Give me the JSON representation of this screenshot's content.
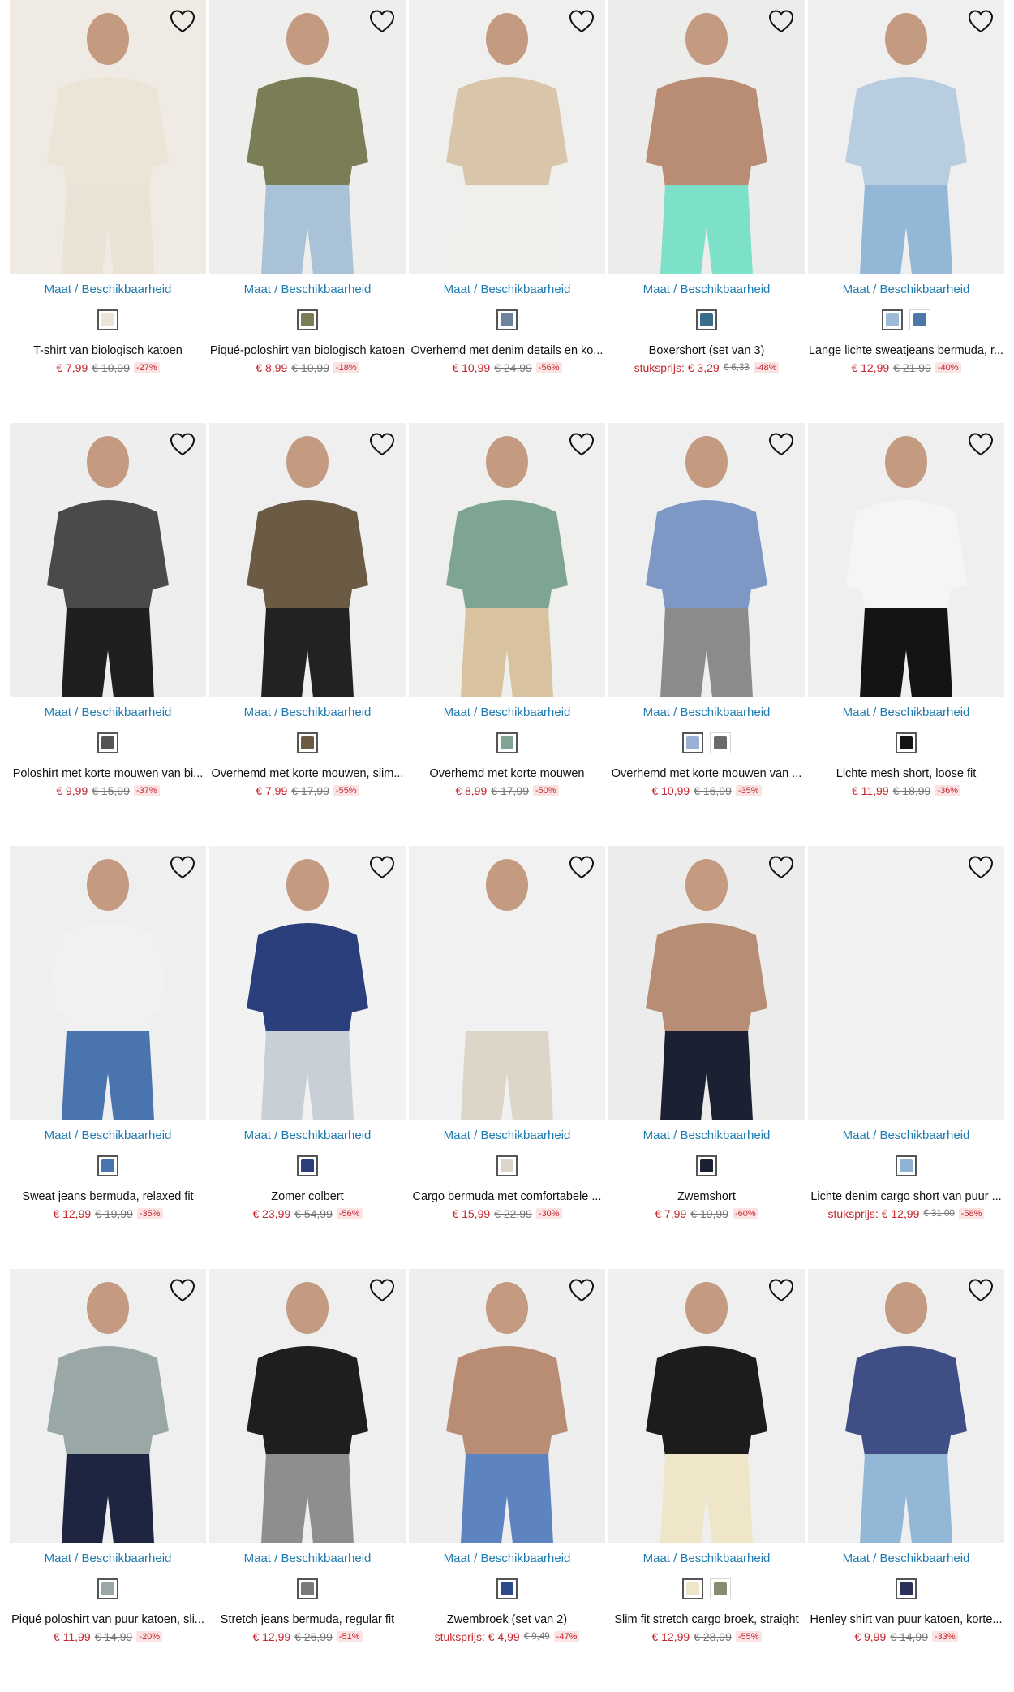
{
  "size_link_label": "Maat / Beschikbaarheid",
  "products": [
    {
      "name": "T-shirt van biologisch katoen",
      "prefix": "",
      "price": "€ 7,99",
      "old": "€ 10,99",
      "discount": "-27%",
      "bg": "#efeae3",
      "body": "#ece4d6",
      "legs": "#e9e2d5",
      "swatches": [
        "#ece4d6"
      ]
    },
    {
      "name": "Piqué-poloshirt van biologisch katoen",
      "prefix": "",
      "price": "€ 8,99",
      "old": "€ 10,99",
      "discount": "-18%",
      "bg": "#eeeeec",
      "body": "#7b7d57",
      "legs": "#a9c2d8",
      "swatches": [
        "#7b7d57"
      ]
    },
    {
      "name": "Overhemd met denim details en ko...",
      "prefix": "",
      "price": "€ 10,99",
      "old": "€ 24,99",
      "discount": "-56%",
      "bg": "#efefed",
      "body": "#d9c5a9",
      "legs": "#f1efe9",
      "swatches": [
        "#6f829c"
      ]
    },
    {
      "name": "Boxershort (set van 3)",
      "prefix": "stuksprijs: ",
      "price": "€ 3,29",
      "old": "€ 6,33",
      "discount": "-48%",
      "bg": "#ececeb",
      "body": "#b98c74",
      "legs": "#7de0c9",
      "swatches": [
        "#3a6d8c"
      ]
    },
    {
      "name": "Lange lichte sweatjeans bermuda, r...",
      "prefix": "",
      "price": "€ 12,99",
      "old": "€ 21,99",
      "discount": "-40%",
      "bg": "#efefef",
      "body": "#b8cde0",
      "legs": "#93b7d6",
      "swatches": [
        "#9dbbd8",
        "#4d77a6"
      ]
    },
    {
      "name": "Poloshirt met korte mouwen van bi...",
      "prefix": "",
      "price": "€ 9,99",
      "old": "€ 15,99",
      "discount": "-37%",
      "bg": "#eeeeee",
      "body": "#4a4a4a",
      "legs": "#1f1f1f",
      "swatches": [
        "#555555"
      ]
    },
    {
      "name": "Overhemd met korte mouwen, slim...",
      "prefix": "",
      "price": "€ 7,99",
      "old": "€ 17,99",
      "discount": "-55%",
      "bg": "#efefef",
      "body": "#6b5b44",
      "legs": "#222222",
      "swatches": [
        "#6b5b44"
      ]
    },
    {
      "name": "Overhemd met korte mouwen",
      "prefix": "",
      "price": "€ 8,99",
      "old": "€ 17,99",
      "discount": "-50%",
      "bg": "#efefed",
      "body": "#7ea494",
      "legs": "#d8c2a0",
      "swatches": [
        "#7ea494"
      ]
    },
    {
      "name": "Overhemd met korte mouwen van ...",
      "prefix": "",
      "price": "€ 10,99",
      "old": "€ 16,99",
      "discount": "-35%",
      "bg": "#efefef",
      "body": "#7e98c6",
      "legs": "#8b8b8b",
      "swatches": [
        "#9ab1d6",
        "#6a6a6a"
      ]
    },
    {
      "name": "Lichte mesh short, loose fit",
      "prefix": "",
      "price": "€ 11,99",
      "old": "€ 18,99",
      "discount": "-36%",
      "bg": "#efefef",
      "body": "#f5f5f5",
      "legs": "#141414",
      "swatches": [
        "#141414"
      ]
    },
    {
      "name": "Sweat jeans bermuda, relaxed fit",
      "prefix": "",
      "price": "€ 12,99",
      "old": "€ 19,99",
      "discount": "-35%",
      "bg": "#efefef",
      "body": "#f1f1f1",
      "legs": "#4a74ae",
      "swatches": [
        "#4a74ae"
      ]
    },
    {
      "name": "Zomer colbert",
      "prefix": "",
      "price": "€ 23,99",
      "old": "€ 54,99",
      "discount": "-56%",
      "bg": "#f2f2f2",
      "body": "#2b3f7c",
      "legs": "#c9cfd7",
      "swatches": [
        "#2b3f7c"
      ]
    },
    {
      "name": "Cargo bermuda met comfortabele ...",
      "prefix": "",
      "price": "€ 15,99",
      "old": "€ 22,99",
      "discount": "-30%",
      "bg": "#f1f1f1",
      "body": "#f1f1f1",
      "legs": "#ddd5c7",
      "swatches": [
        "#ddd5c7"
      ]
    },
    {
      "name": "Zwemshort",
      "prefix": "",
      "price": "€ 7,99",
      "old": "€ 19,99",
      "discount": "-60%",
      "bg": "#ececec",
      "body": "#b88d76",
      "legs": "#1b2033",
      "swatches": [
        "#1b2033"
      ]
    },
    {
      "name": "Lichte denim cargo short van puur ...",
      "prefix": "stuksprijs: ",
      "price": "€ 12,99",
      "old": "€ 31,00",
      "discount": "-58%",
      "bg": "#f2f2f2",
      "body": "#f2f2f2",
      "legs": "#f2f2f2",
      "swatches": [
        "#8fb1d4"
      ]
    },
    {
      "name": "Piqué poloshirt van puur katoen, sli...",
      "prefix": "",
      "price": "€ 11,99",
      "old": "€ 14,99",
      "discount": "-20%",
      "bg": "#efefef",
      "body": "#99a8a6",
      "legs": "#1e2540",
      "swatches": [
        "#99a8a6"
      ]
    },
    {
      "name": "Stretch jeans bermuda, regular fit",
      "prefix": "",
      "price": "€ 12,99",
      "old": "€ 26,99",
      "discount": "-51%",
      "bg": "#efefef",
      "body": "#1e1e1e",
      "legs": "#8e8e8e",
      "swatches": [
        "#7a7a7a"
      ]
    },
    {
      "name": "Zwembroek (set van 2)",
      "prefix": "stuksprijs: ",
      "price": "€ 4,99",
      "old": "€ 9,49",
      "discount": "-47%",
      "bg": "#eeeeee",
      "body": "#b98c74",
      "legs": "#5d83c0",
      "swatches": [
        "#2a4a8a"
      ]
    },
    {
      "name": "Slim fit stretch cargo broek, straight",
      "prefix": "",
      "price": "€ 12,99",
      "old": "€ 28,99",
      "discount": "-55%",
      "bg": "#efefef",
      "body": "#1c1c1c",
      "legs": "#efe6c9",
      "swatches": [
        "#efe6c9",
        "#8a8a70"
      ]
    },
    {
      "name": "Henley shirt van puur katoen, korte...",
      "prefix": "",
      "price": "€ 9,99",
      "old": "€ 14,99",
      "discount": "-33%",
      "bg": "#efefef",
      "body": "#3f4f86",
      "legs": "#93b7d6",
      "swatches": [
        "#2b335a"
      ]
    }
  ]
}
